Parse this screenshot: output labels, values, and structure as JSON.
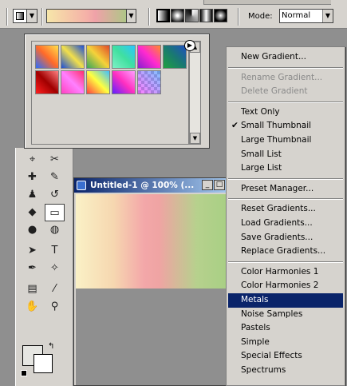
{
  "options_bar": {
    "mode_label": "Mode:",
    "mode_value": "Normal",
    "gradient_types": [
      "linear",
      "radial",
      "angle",
      "reflected",
      "diamond"
    ]
  },
  "document": {
    "title": "Untitled-1 @ 100% (..."
  },
  "gradient_picker": {
    "swatches": [
      {
        "name": "blue-red-yellow",
        "colors": [
          "#2a6cff",
          "#ff6a2a",
          "#ffe14a"
        ]
      },
      {
        "name": "blue-yellow-blue",
        "colors": [
          "#1c4fd8",
          "#f3e04a",
          "#1c4fd8"
        ]
      },
      {
        "name": "orange-yellow-orange",
        "colors": [
          "#3aa75a",
          "#f5d23a",
          "#e04a2a"
        ]
      },
      {
        "name": "spectrum-light",
        "colors": [
          "#7ef0c6",
          "#40e0a0",
          "#2ac6ff"
        ]
      },
      {
        "name": "violet-orange",
        "colors": [
          "#8a1fd0",
          "#ff2ad0",
          "#ff8a2a"
        ]
      },
      {
        "name": "green-blue",
        "colors": [
          "#20a040",
          "#1a7a70",
          "#2050c0"
        ]
      },
      {
        "name": "red-dark",
        "colors": [
          "#ff2020",
          "#a00000",
          "#ff8080"
        ]
      },
      {
        "name": "pink-violet",
        "colors": [
          "#ff40c0",
          "#ff80ff",
          "#ff3070"
        ]
      },
      {
        "name": "rainbow",
        "colors": [
          "#ff4040",
          "#ffff40",
          "#40c0ff"
        ]
      },
      {
        "name": "violet-pink",
        "colors": [
          "#6020ff",
          "#ff30c0",
          "#ffa0ff"
        ]
      },
      {
        "name": "transparent-stripes",
        "colors": [
          "#ffffff",
          "#c0c0ff",
          "#ffc0ff"
        ]
      }
    ]
  },
  "menu": {
    "items": [
      {
        "label": "New Gradient...",
        "state": "normal"
      },
      {
        "sep": true
      },
      {
        "label": "Rename Gradient...",
        "state": "disabled"
      },
      {
        "label": "Delete Gradient",
        "state": "disabled"
      },
      {
        "sep": true
      },
      {
        "label": "Text Only",
        "state": "normal"
      },
      {
        "label": "Small Thumbnail",
        "state": "checked"
      },
      {
        "label": "Large Thumbnail",
        "state": "normal"
      },
      {
        "label": "Small List",
        "state": "normal"
      },
      {
        "label": "Large List",
        "state": "normal"
      },
      {
        "sep": true
      },
      {
        "label": "Preset Manager...",
        "state": "normal"
      },
      {
        "sep": true
      },
      {
        "label": "Reset Gradients...",
        "state": "normal"
      },
      {
        "label": "Load Gradients...",
        "state": "normal"
      },
      {
        "label": "Save Gradients...",
        "state": "normal"
      },
      {
        "label": "Replace Gradients...",
        "state": "normal"
      },
      {
        "sep": true
      },
      {
        "label": "Color Harmonies 1",
        "state": "normal"
      },
      {
        "label": "Color Harmonies 2",
        "state": "normal"
      },
      {
        "label": "Metals",
        "state": "highlighted"
      },
      {
        "label": "Noise Samples",
        "state": "normal"
      },
      {
        "label": "Pastels",
        "state": "normal"
      },
      {
        "label": "Simple",
        "state": "normal"
      },
      {
        "label": "Special Effects",
        "state": "normal"
      },
      {
        "label": "Spectrums",
        "state": "normal"
      }
    ]
  },
  "toolbox": {
    "tools": [
      {
        "name": "slice-tool-icon",
        "glyph": "⌖"
      },
      {
        "name": "slice-select-icon",
        "glyph": "✂"
      },
      {
        "name": "healing-brush-icon",
        "glyph": "✚"
      },
      {
        "name": "brush-icon",
        "glyph": "✎"
      },
      {
        "name": "clone-stamp-icon",
        "glyph": "♟"
      },
      {
        "name": "history-brush-icon",
        "glyph": "↺"
      },
      {
        "name": "eraser-icon",
        "glyph": "◆"
      },
      {
        "name": "gradient-tool-icon",
        "glyph": "▭"
      },
      {
        "name": "blur-icon",
        "glyph": "●"
      },
      {
        "name": "dodge-icon",
        "glyph": "◍"
      },
      {
        "name": "path-select-icon",
        "glyph": "➤"
      },
      {
        "name": "type-icon",
        "glyph": "T"
      },
      {
        "name": "pen-icon",
        "glyph": "✒"
      },
      {
        "name": "shape-icon",
        "glyph": "✧"
      },
      {
        "name": "notes-icon",
        "glyph": "▤"
      },
      {
        "name": "eyedropper-icon",
        "glyph": "⁄"
      },
      {
        "name": "hand-icon",
        "glyph": "✋"
      },
      {
        "name": "zoom-icon",
        "glyph": "⚲"
      }
    ]
  }
}
